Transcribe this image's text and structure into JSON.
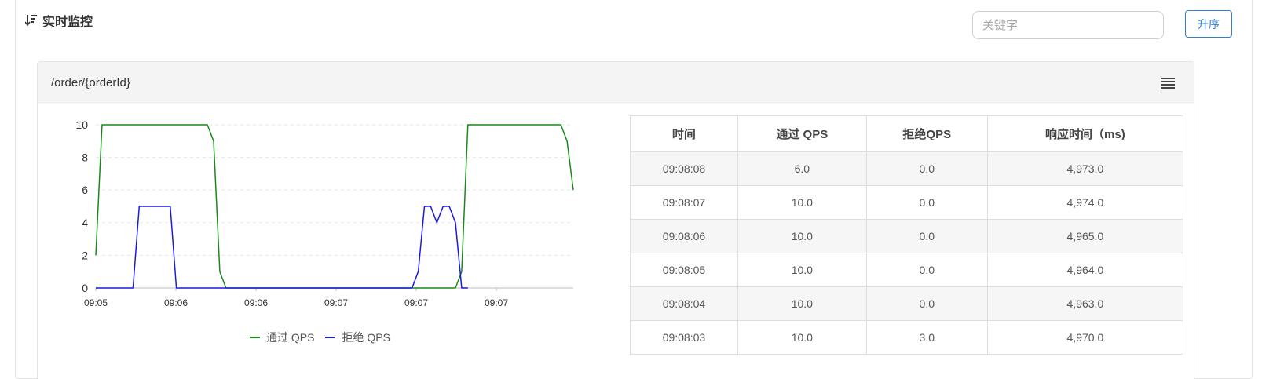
{
  "panel": {
    "title": "实时监控",
    "search_placeholder": "关键字",
    "sort_label": "升序"
  },
  "card": {
    "title": "/order/{orderId}"
  },
  "chart_data": {
    "type": "line",
    "title": "",
    "xlabel": "",
    "ylabel": "",
    "ylim": [
      0,
      10
    ],
    "yticks": [
      0,
      2,
      4,
      6,
      8,
      10
    ],
    "xtick_labels": [
      "09:05",
      "09:06",
      "09:06",
      "09:07",
      "09:07",
      "09:07"
    ],
    "grid": "horizontal-dashed",
    "legend_position": "bottom-center",
    "series": [
      {
        "name": "通过 QPS",
        "color": "#1a8a1a",
        "x": [
          0,
          1,
          2,
          3,
          18,
          19,
          20,
          21,
          22,
          58,
          59,
          60,
          61,
          62,
          74,
          75,
          76,
          77
        ],
        "values": [
          2,
          10,
          10,
          10,
          10,
          9,
          1,
          0,
          0,
          0,
          1,
          10,
          10,
          10,
          10,
          10,
          9,
          6
        ]
      },
      {
        "name": "拒绝 QPS",
        "color": "#1a1ae6",
        "x": [
          0,
          5,
          6,
          7,
          8,
          11,
          12,
          13,
          14,
          50,
          51,
          52,
          53,
          54,
          55,
          56,
          57,
          58,
          59,
          60
        ],
        "values": [
          0,
          0,
          0,
          5,
          5,
          5,
          5,
          0,
          0,
          0,
          0,
          1,
          5,
          5,
          4,
          5,
          5,
          4,
          0,
          0
        ]
      }
    ]
  },
  "table": {
    "headers": [
      "时间",
      "通过 QPS",
      "拒绝QPS",
      "响应时间（ms)"
    ],
    "rows": [
      [
        "09:08:08",
        "6.0",
        "0.0",
        "4,973.0"
      ],
      [
        "09:08:07",
        "10.0",
        "0.0",
        "4,974.0"
      ],
      [
        "09:08:06",
        "10.0",
        "0.0",
        "4,965.0"
      ],
      [
        "09:08:05",
        "10.0",
        "0.0",
        "4,964.0"
      ],
      [
        "09:08:04",
        "10.0",
        "0.0",
        "4,963.0"
      ],
      [
        "09:08:03",
        "10.0",
        "3.0",
        "4,970.0"
      ]
    ]
  }
}
